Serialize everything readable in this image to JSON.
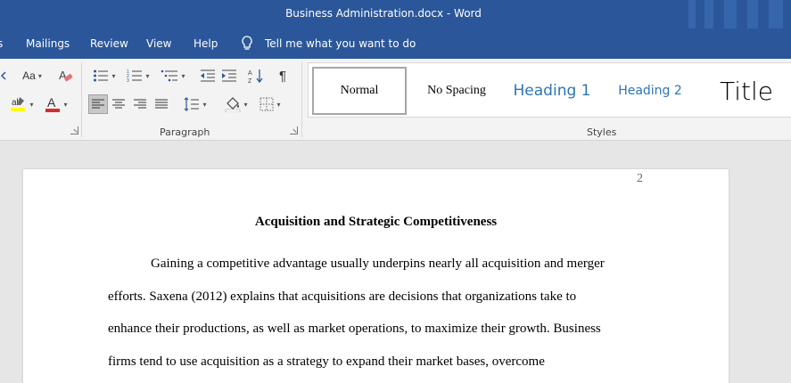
{
  "window": {
    "title": "Business Administration.docx  -  Word"
  },
  "menu": {
    "items": [
      "Mailings",
      "Review",
      "View",
      "Help"
    ],
    "tell_me": "Tell me what you want to do",
    "tell_me_icon": "lightbulb-icon"
  },
  "ribbon": {
    "font_group": {
      "change_case": "Aa",
      "font_color": "#d32f2f",
      "highlight_color": "#ffff00"
    },
    "paragraph_group": {
      "label": "Paragraph",
      "show_marks": "¶"
    },
    "styles_group": {
      "label": "Styles",
      "items": [
        "Normal",
        "No Spacing",
        "Heading 1",
        "Heading 2",
        "Title"
      ],
      "heading_color": "#2e74b5"
    }
  },
  "document": {
    "page_number": "2",
    "title": "Acquisition and Strategic Competitiveness",
    "lines": [
      "Gaining a competitive advantage usually underpins nearly all acquisition and merger",
      "efforts. Saxena (2012) explains that acquisitions are decisions that organizations take to",
      "enhance their productions, as well as market operations, to maximize their growth. Business",
      "firms tend to use acquisition as a strategy to expand their market bases, overcome"
    ]
  },
  "colors": {
    "brand": "#2b579a",
    "ribbon": "#f3f3f3",
    "canvas": "#e6e6e6"
  }
}
